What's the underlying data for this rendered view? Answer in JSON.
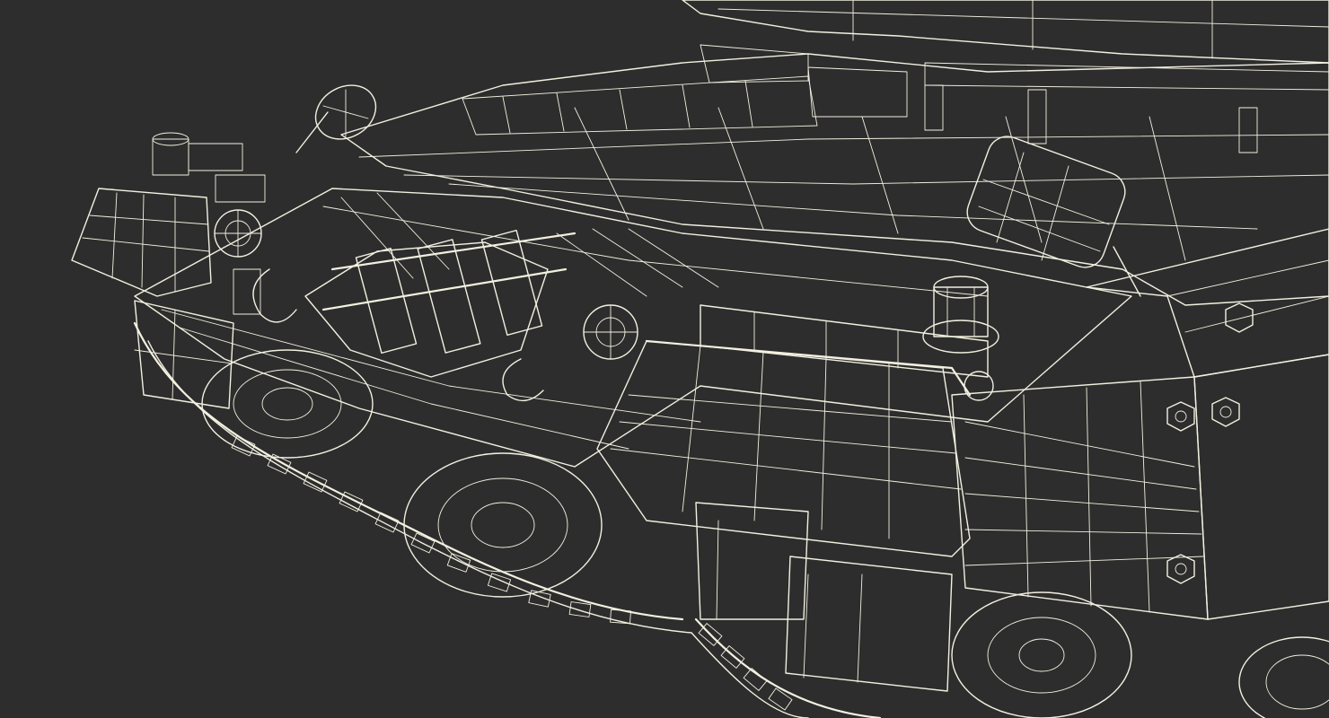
{
  "scene": {
    "background_color": "#2d2d2d",
    "wire_color": "#f2f0e0",
    "surface_color": "#5a5a55",
    "surface_dark_color": "#3f3f3c",
    "surface_light_color": "#6e6e68",
    "render_style": "wireframe-on-shaded"
  }
}
